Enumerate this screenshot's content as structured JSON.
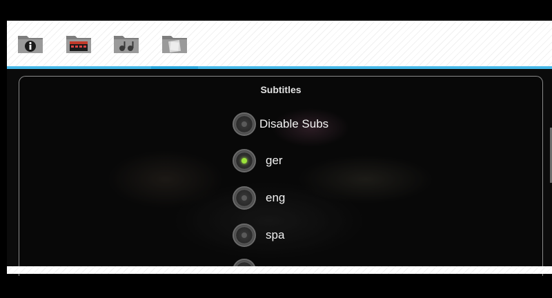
{
  "tabs": [
    {
      "icon": "folder-info-icon",
      "active": false
    },
    {
      "icon": "folder-video-icon",
      "active": false
    },
    {
      "icon": "folder-audio-icon",
      "active": false
    },
    {
      "icon": "folder-subtitles-icon",
      "active": true
    }
  ],
  "dialog": {
    "title": "Subtitles",
    "options": [
      {
        "label": "Disable Subs",
        "selected": false
      },
      {
        "label": "ger",
        "selected": true
      },
      {
        "label": "eng",
        "selected": false
      },
      {
        "label": "spa",
        "selected": false
      }
    ]
  },
  "colors": {
    "accent": "#2aa8de",
    "selected_dot": "#9be23a"
  }
}
